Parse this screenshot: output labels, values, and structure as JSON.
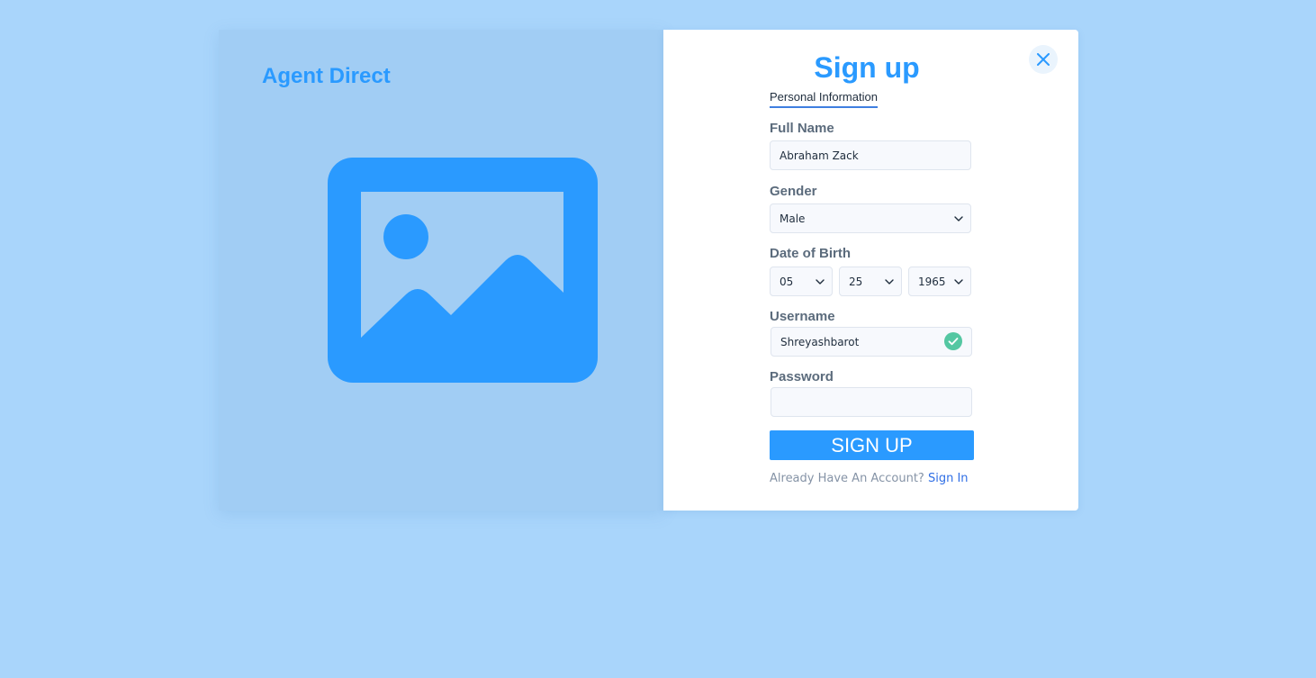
{
  "brand": {
    "name": "Agent Direct"
  },
  "hero": {
    "icon": "image-placeholder-icon"
  },
  "dialog": {
    "title": "Sign up",
    "close_icon": "close-icon",
    "section_tab": "Personal Information",
    "full_name": {
      "label": "Full Name",
      "value": "Abraham Zack"
    },
    "gender": {
      "label": "Gender",
      "value": "Male"
    },
    "dob": {
      "label": "Date of Birth",
      "month": "05",
      "day": "25",
      "year": "1965"
    },
    "username": {
      "label": "Username",
      "value": "Shreyashbarot",
      "status_icon": "check-circle-icon"
    },
    "password": {
      "label": "Password",
      "value": ""
    },
    "submit_label": "SIGN UP",
    "account_prompt": "Already Have An Account?",
    "signin_label": "Sign In"
  },
  "colors": {
    "page_background": "#a9d5fb",
    "left_panel": "#a1cdf4",
    "accent": "#2a9aff",
    "link": "#2f6ee5",
    "success": "#54c7a2"
  }
}
